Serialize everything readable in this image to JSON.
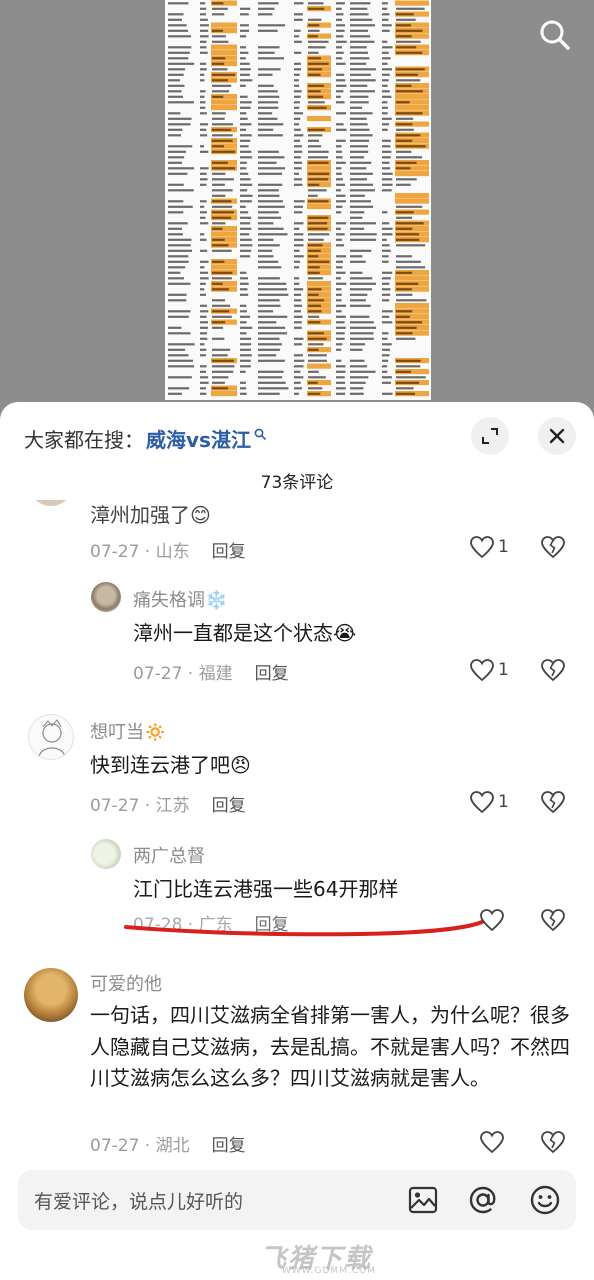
{
  "header": {
    "search_prefix": "大家都在搜：",
    "search_term": "威海vs湛江",
    "comment_count": "73条评论"
  },
  "icons": {
    "top_search": "search-icon",
    "expand": "expand-icon",
    "close": "close-icon",
    "like": "heart-icon",
    "dislike": "broken-heart-icon",
    "image": "image-icon",
    "mention": "at-icon",
    "emoji": "emoji-icon"
  },
  "colors": {
    "accent_link": "#2c5da6",
    "annotation_line": "#d8201c",
    "sheet_highlight": "#f0a640"
  },
  "comments": [
    {
      "id": "c0",
      "text_partial": "漳州加强了",
      "emoji": "😊",
      "date": "07-27",
      "region": "山东",
      "reply": "回复",
      "likes": "1"
    },
    {
      "id": "c1",
      "user": "痛失格调",
      "user_suffix": "❄️",
      "text": "漳州一直都是这个状态",
      "emoji": "😭",
      "date": "07-27",
      "region": "福建",
      "reply": "回复",
      "likes": "1"
    },
    {
      "id": "c2",
      "user": "想叮当",
      "user_suffix": "🔅",
      "text": "快到连云港了吧",
      "emoji": "😠",
      "date": "07-27",
      "region": "江苏",
      "reply": "回复",
      "likes": "1"
    },
    {
      "id": "c3",
      "user": "两广总督",
      "text": "江门比连云港强一些64开那样",
      "date": "07-28",
      "region": "广东",
      "reply": "回复",
      "likes": ""
    },
    {
      "id": "c4",
      "user": "可爱的他",
      "text": "一句话，四川艾滋病全省排第一害人，为什么呢？很多人隐藏自己艾滋病，去是乱搞。不就是害人吗？不然四川艾滋病怎么这么多？四川艾滋病就是害人。",
      "date": "07-27",
      "region": "湖北",
      "reply": "回复",
      "likes": ""
    }
  ],
  "input": {
    "placeholder": "有爱评论，说点儿好听的"
  },
  "watermark": {
    "main": "飞猪下载",
    "sub": "WWW.GDMM.COM"
  }
}
